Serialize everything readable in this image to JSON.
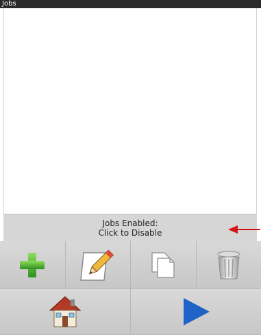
{
  "window": {
    "title": "Jobs"
  },
  "status": {
    "line1": "Jobs Enabled:",
    "line2": "Click to Disable"
  },
  "toolbar": {
    "row1": [
      {
        "icon": "plus-icon",
        "color": "#3fa72c"
      },
      {
        "icon": "pencil-icon",
        "color": "#e6b84a"
      },
      {
        "icon": "copy-icon",
        "color": "#ffffff"
      },
      {
        "icon": "trash-icon",
        "color": "#c9c9c9"
      }
    ],
    "row2": [
      {
        "icon": "home-icon",
        "color": "#9b3b23"
      },
      {
        "icon": "play-icon",
        "color": "#1f63c6"
      }
    ]
  },
  "annotation": {
    "icon": "red-arrow-icon",
    "color": "#d11717"
  }
}
